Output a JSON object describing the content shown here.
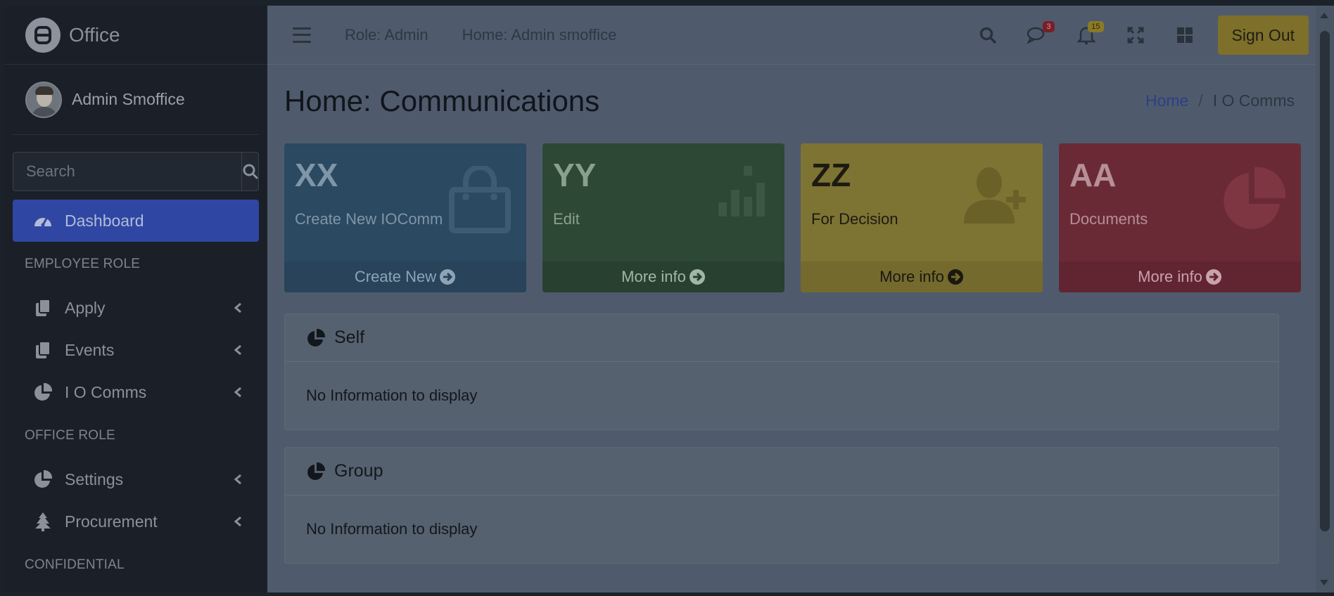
{
  "sidebar": {
    "brand": "Office",
    "user_name": "Admin Smoffice",
    "search_placeholder": "Search",
    "items": [
      {
        "type": "item",
        "label": "Dashboard",
        "icon": "dashboard-icon",
        "active": true
      },
      {
        "type": "header",
        "label": "EMPLOYEE ROLE"
      },
      {
        "type": "item",
        "label": "Apply",
        "icon": "copy-icon"
      },
      {
        "type": "item",
        "label": "Events",
        "icon": "copy-icon"
      },
      {
        "type": "item",
        "label": "I O Comms",
        "icon": "pie-chart-icon"
      },
      {
        "type": "header",
        "label": "OFFICE ROLE"
      },
      {
        "type": "item",
        "label": "Settings",
        "icon": "pie-chart-icon"
      },
      {
        "type": "item",
        "label": "Procurement",
        "icon": "tree-icon"
      },
      {
        "type": "header",
        "label": "CONFIDENTIAL"
      }
    ]
  },
  "topbar": {
    "role": "Role: Admin",
    "home": "Home: Admin smoffice",
    "messages_count": "3",
    "notifications_count": "15",
    "sign_out": "Sign Out"
  },
  "page": {
    "title": "Home: Communications",
    "breadcrumb": {
      "home": "Home",
      "separator": "/",
      "current": "I O Comms"
    }
  },
  "boxes": [
    {
      "value": "XX",
      "label": "Create New IOComm",
      "footer": "Create New",
      "color": "#2b4960",
      "icon": "shopping-bag-icon"
    },
    {
      "value": "YY",
      "label": "Edit",
      "footer": "More info",
      "color": "#2d4835",
      "icon": "bar-chart-icon"
    },
    {
      "value": "ZZ",
      "label": "For Decision",
      "footer": "More info",
      "color": "#7d7333",
      "icon": "user-plus-icon"
    },
    {
      "value": "AA",
      "label": "Documents",
      "footer": "More info",
      "color": "#6a2a35",
      "icon": "pie-chart-icon"
    }
  ],
  "cards": [
    {
      "title": "Self",
      "body": "No Information to display"
    },
    {
      "title": "Group",
      "body": "No Information to display"
    }
  ]
}
